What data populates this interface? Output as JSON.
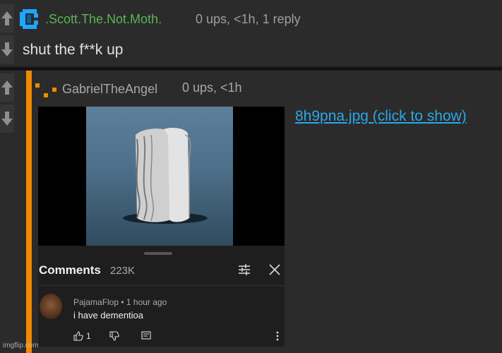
{
  "comment1": {
    "username": ".Scott.The.Not.Moth.",
    "meta": "0 ups, <1h, 1 reply",
    "body": "shut the f**k up",
    "avatar_icon": "pixel-avatar-blue-icon",
    "username_color": "#5ab552"
  },
  "comment2": {
    "username": "GabrielTheAngel",
    "meta": "0 ups, <1h",
    "image_link": "8h9pna.jpg (click to show)",
    "avatar_icon": "pixel-avatar-orange-icon",
    "reply_bar_color": "#f08a00",
    "link_color": "#2aa7e8"
  },
  "embed": {
    "comments_title": "Comments",
    "comments_count": "223K",
    "comment_user": "PajamaFlop • 1 hour ago",
    "comment_text": "i have dementioa",
    "like_count": "1"
  },
  "watermark": "imgflip.com",
  "icons": {
    "upvote": "arrow-up-icon",
    "downvote": "arrow-down-icon",
    "filter": "filter-icon",
    "close": "close-icon",
    "like": "thumbs-up-icon",
    "dislike": "thumbs-down-icon",
    "reply": "reply-icon",
    "more": "more-vertical-icon"
  }
}
